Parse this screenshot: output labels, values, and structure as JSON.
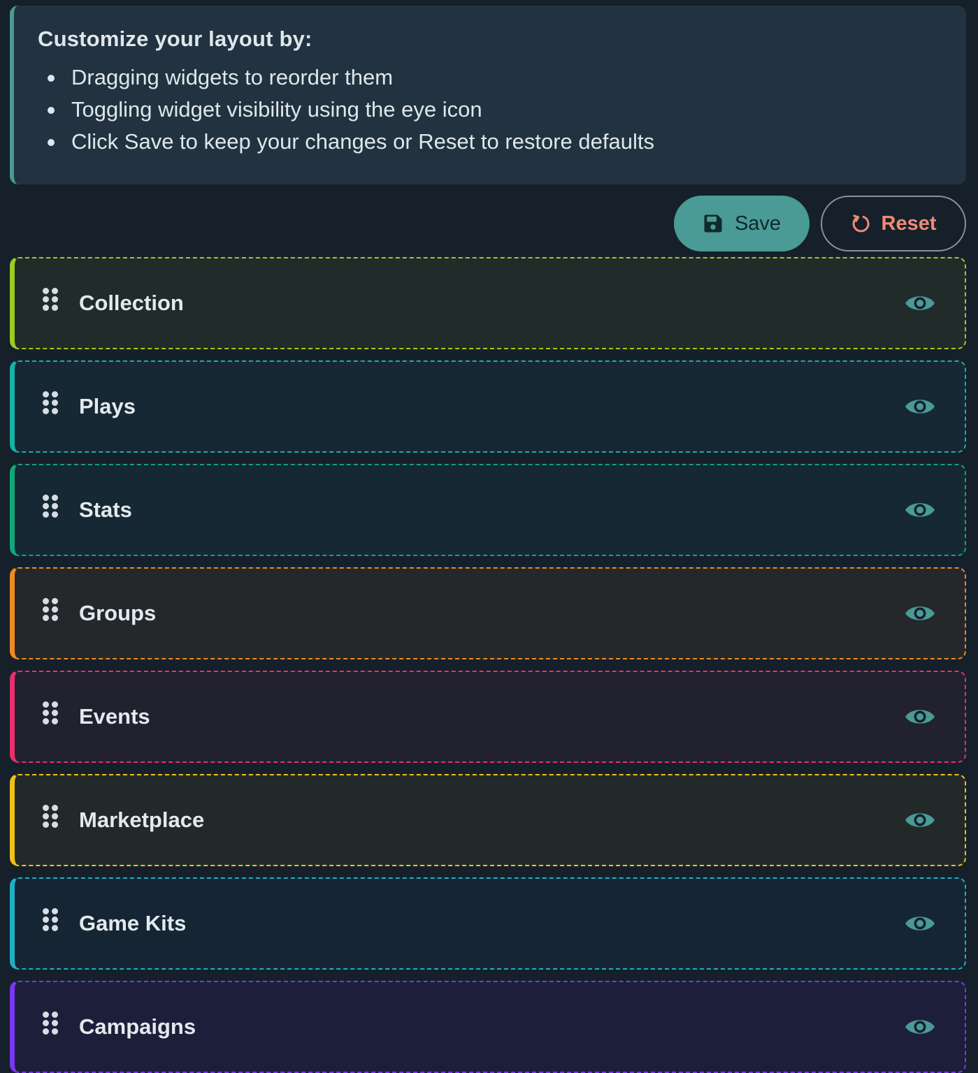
{
  "info": {
    "title": "Customize your layout by:",
    "bullets": [
      "Dragging widgets to reorder them",
      "Toggling widget visibility using the eye icon",
      "Click Save to keep your changes or Reset to restore defaults"
    ]
  },
  "toolbar": {
    "save_label": "Save",
    "save_icon": "floppy-disk-icon",
    "reset_label": "Reset",
    "reset_icon": "rotate-ccw-icon"
  },
  "colors": {
    "teal": "#4a9a96",
    "reset_text": "#f08a75"
  },
  "widgets": [
    {
      "label": "Collection",
      "accent": "#9acd1e",
      "bg": "#212b2a",
      "visible": true
    },
    {
      "label": "Plays",
      "accent": "#14b3a5",
      "bg": "#162833",
      "visible": true
    },
    {
      "label": "Stats",
      "accent": "#11a57a",
      "bg": "#162833",
      "visible": true
    },
    {
      "label": "Groups",
      "accent": "#f08a1e",
      "bg": "#24282b",
      "visible": true
    },
    {
      "label": "Events",
      "accent": "#e8306e",
      "bg": "#22212f",
      "visible": true
    },
    {
      "label": "Marketplace",
      "accent": "#f2c014",
      "bg": "#222a29",
      "visible": true
    },
    {
      "label": "Game Kits",
      "accent": "#1cb1c4",
      "bg": "#162533",
      "visible": true
    },
    {
      "label": "Campaigns",
      "accent": "#7a36f0",
      "bg": "#1d1f3a",
      "visible": true
    }
  ]
}
